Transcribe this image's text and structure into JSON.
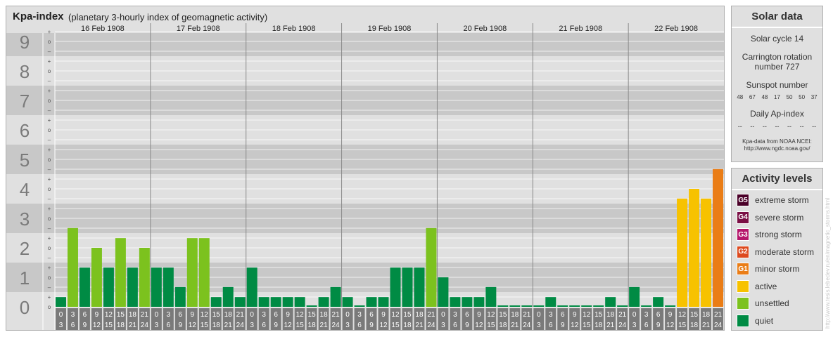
{
  "title": "Kpa-index",
  "subtitle": "(planetary 3-hourly index of geomagnetic activity)",
  "chart_data": {
    "type": "bar",
    "title": "Kpa-index",
    "subtitle": "(planetary 3-hourly index of geomagnetic activity)",
    "y_axis": {
      "ylim": [
        0,
        9
      ],
      "tick_labels": [
        "0",
        "1",
        "2",
        "3",
        "4",
        "5",
        "6",
        "7",
        "8",
        "9"
      ],
      "minor_tick_labels": [
        "–",
        "o",
        "+"
      ]
    },
    "days": [
      "16 Feb 1908",
      "17 Feb 1908",
      "18 Feb 1908",
      "19 Feb 1908",
      "20 Feb 1908",
      "21 Feb 1908",
      "22 Feb 1908"
    ],
    "interval_labels": [
      [
        "0",
        "3"
      ],
      [
        "3",
        "6"
      ],
      [
        "6",
        "9"
      ],
      [
        "9",
        "12"
      ],
      [
        "12",
        "15"
      ],
      [
        "15",
        "18"
      ],
      [
        "18",
        "21"
      ],
      [
        "21",
        "24"
      ]
    ],
    "values": [
      [
        0.33,
        2.67,
        1.33,
        2.0,
        1.33,
        2.33,
        1.33,
        2.0
      ],
      [
        1.33,
        1.33,
        0.67,
        2.33,
        2.33,
        0.33,
        0.67,
        0.33
      ],
      [
        1.33,
        0.33,
        0.33,
        0.33,
        0.33,
        0.0,
        0.33,
        0.67
      ],
      [
        0.33,
        0.0,
        0.33,
        0.33,
        1.33,
        1.33,
        1.33,
        2.67
      ],
      [
        1.0,
        0.33,
        0.33,
        0.33,
        0.67,
        0.0,
        0.0,
        0.0
      ],
      [
        0.0,
        0.33,
        0.0,
        0.0,
        0.0,
        0.0,
        0.33,
        0.0
      ],
      [
        0.67,
        0.0,
        0.33,
        0.0,
        3.67,
        4.0,
        3.67,
        4.67
      ]
    ],
    "grid": true
  },
  "solar": {
    "heading": "Solar data",
    "cycle": "Solar cycle 14",
    "rotation_line1": "Carrington rotation",
    "rotation_line2": "number 727",
    "sunspot_label": "Sunspot number",
    "sunspot_values": [
      "48",
      "67",
      "48",
      "17",
      "50",
      "50",
      "37"
    ],
    "ap_label": "Daily Ap-index",
    "ap_values": [
      "--",
      "--",
      "--",
      "--",
      "--",
      "--",
      "--"
    ],
    "source_line1": "Kpa-data from NOAA NCEI:",
    "source_line2": "http://www.ngdc.noaa.gov/"
  },
  "activity": {
    "heading": "Activity levels",
    "levels": [
      {
        "code": "G5",
        "label": "extreme storm",
        "color": "#4a0028"
      },
      {
        "code": "G4",
        "label": "severe storm",
        "color": "#7b0f45"
      },
      {
        "code": "G3",
        "label": "strong storm",
        "color": "#b5166b"
      },
      {
        "code": "G2",
        "label": "moderate storm",
        "color": "#dd4a1f"
      },
      {
        "code": "G1",
        "label": "minor storm",
        "color": "#ea7d16"
      },
      {
        "code": "",
        "label": "active",
        "color": "#f7c200"
      },
      {
        "code": "",
        "label": "unsettled",
        "color": "#7cc21e"
      },
      {
        "code": "",
        "label": "quiet",
        "color": "#008b44"
      }
    ]
  },
  "credit": "http://www.tesis.lebedev.ru/en/magnetic_storms.html"
}
